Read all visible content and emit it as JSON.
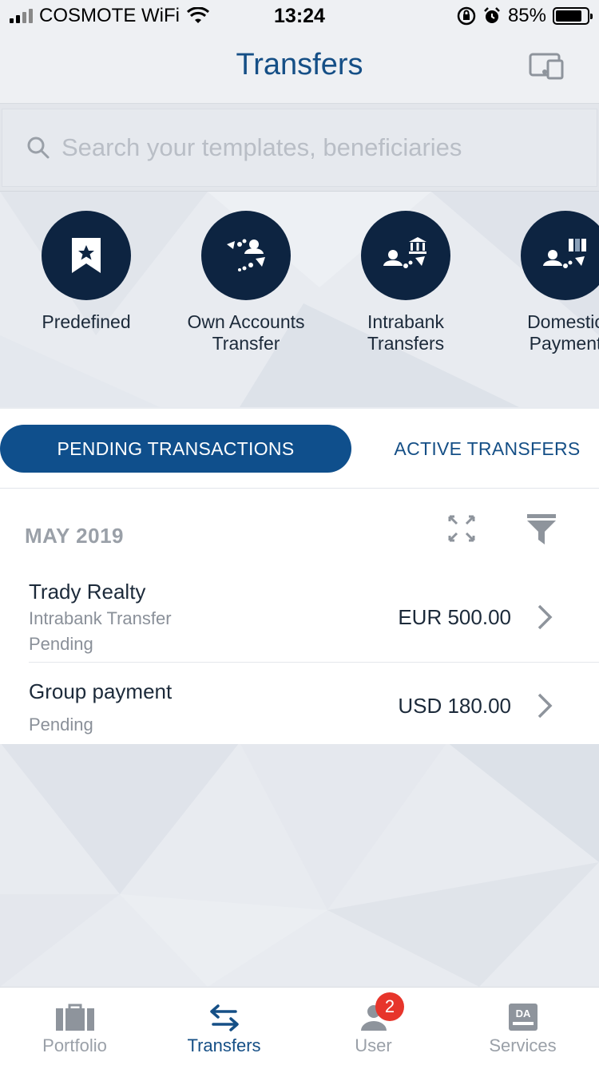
{
  "status_bar": {
    "carrier": "COSMOTE WiFi",
    "time": "13:24",
    "battery": "85%",
    "battery_level": 0.85
  },
  "header": {
    "title": "Transfers",
    "device_icon": "devices-icon"
  },
  "search": {
    "placeholder": "Search your templates, beneficiaries"
  },
  "quick_actions": [
    {
      "label_line1": "Predefined",
      "label_line2": "",
      "icon": "bookmark-star-icon"
    },
    {
      "label_line1": "Own Accounts",
      "label_line2": "Transfer",
      "icon": "own-accounts-icon"
    },
    {
      "label_line1": "Intrabank",
      "label_line2": "Transfers",
      "icon": "intrabank-icon"
    },
    {
      "label_line1": "Domestic",
      "label_line2": "Payment",
      "icon": "domestic-payment-icon"
    }
  ],
  "tabs": {
    "pending": "PENDING TRANSACTIONS",
    "active": "ACTIVE TRANSFERS"
  },
  "transactions": {
    "month": "MAY 2019",
    "items": [
      {
        "name": "Trady Realty",
        "type": "Intrabank Transfer",
        "status": "Pending",
        "amount": "EUR 500.00"
      },
      {
        "name": "Group payment",
        "type": "",
        "status": "Pending",
        "amount": "USD 180.00"
      }
    ]
  },
  "bottom_nav": {
    "items": [
      {
        "label": "Portfolio",
        "icon": "briefcase-icon"
      },
      {
        "label": "Transfers",
        "icon": "arrows-exchange-icon"
      },
      {
        "label": "User",
        "icon": "user-icon",
        "badge": "2"
      },
      {
        "label": "Services",
        "icon": "da-services-icon"
      }
    ]
  },
  "colors": {
    "primary": "#0f4f8c",
    "circle": "#0d2441",
    "badge": "#e7352b"
  }
}
